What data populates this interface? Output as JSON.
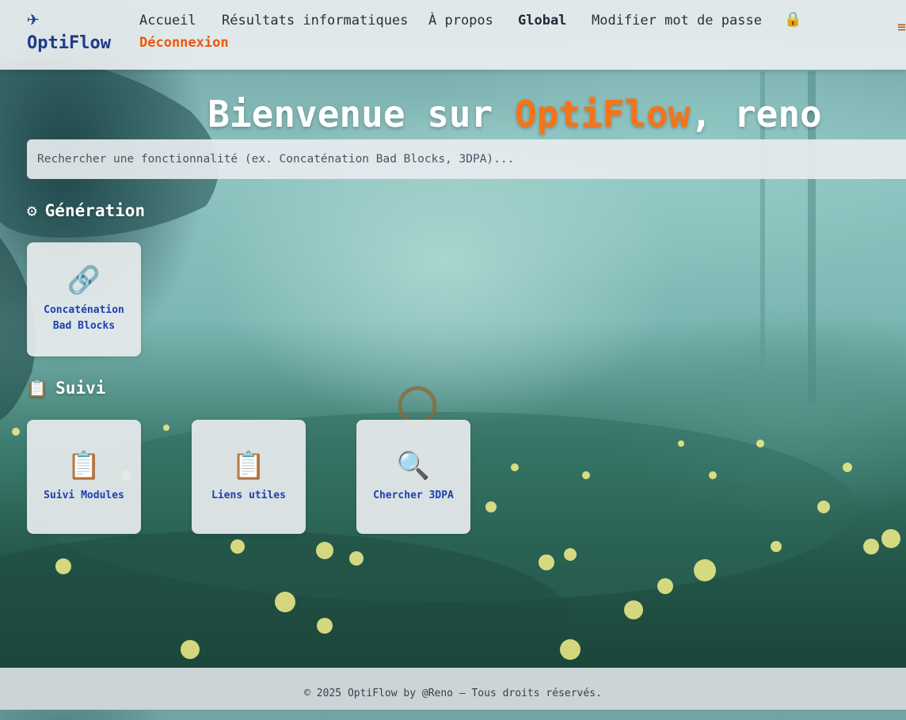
{
  "brand": {
    "icon": "✈",
    "name": "OptiFlow"
  },
  "nav": {
    "items": [
      {
        "label": "Accueil"
      },
      {
        "label": "Résultats informatiques"
      },
      {
        "label": "À propos"
      },
      {
        "label": "Global"
      },
      {
        "label": "Modifier mot de passe"
      }
    ],
    "lock_icon": "🔒",
    "logout_label": "Déconnexion"
  },
  "welcome": {
    "prefix": "Bienvenue sur ",
    "brand": "OptiFlow",
    "suffix": ", reno"
  },
  "search": {
    "placeholder": "Rechercher une fonctionnalité (ex. Concaténation Bad Blocks, 3DPA)...",
    "value": ""
  },
  "sections": [
    {
      "icon": "⚙",
      "title": "Génération",
      "cards": [
        {
          "icon": "🔗",
          "label": "Concaténation Bad Blocks"
        }
      ]
    },
    {
      "icon": "📋",
      "title": "Suivi",
      "cards": [
        {
          "icon": "📋",
          "label": "Suivi Modules"
        },
        {
          "icon": "📋",
          "label": "Liens utiles"
        },
        {
          "icon": "🔍",
          "label": "Chercher 3DPA"
        }
      ]
    }
  ],
  "footer": {
    "text": "© 2025 OptiFlow by @Reno — Tous droits réservés."
  },
  "colors": {
    "brand_blue": "#1e3a8a",
    "accent_orange": "#f97316",
    "link_blue": "#1e40af"
  }
}
